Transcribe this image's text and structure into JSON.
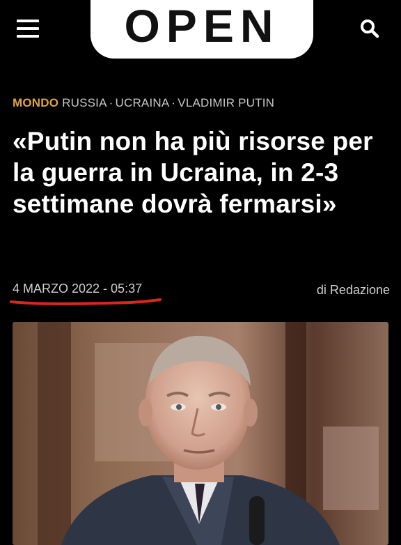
{
  "header": {
    "logo_text": "OPEN",
    "menu_icon": "hamburger-menu-icon",
    "search_icon": "search-icon",
    "logo_bg": "#ffffff"
  },
  "article": {
    "section": "MONDO",
    "tags": [
      "RUSSIA",
      "UCRAINA",
      "VLADIMIR PUTIN"
    ],
    "headline": "«Putin non ha più risorse per la guerra in Ucraina, in 2-3 settimane dovrà fermarsi»",
    "date": "4 MARZO 2022 - 05:37",
    "byline": "di Redazione"
  },
  "colors": {
    "background": "#000000",
    "section_accent": "#e0a43a",
    "underline_annotation": "#d8281e"
  }
}
